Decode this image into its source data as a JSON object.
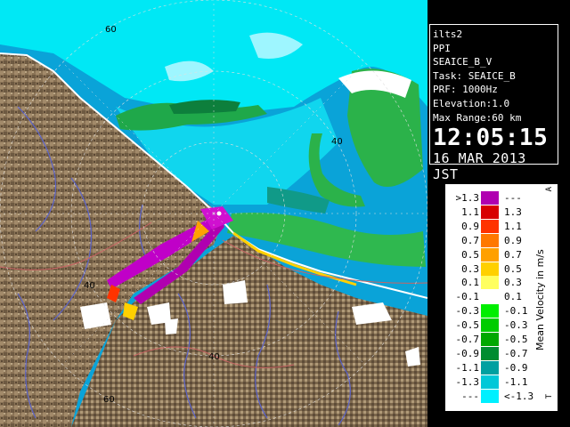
{
  "info": {
    "site": "ilts2",
    "product": "PPI",
    "product_name": "SEAICE_B_V",
    "task": "Task: SEAICE_B",
    "prf": "PRF: 1000Hz",
    "elevation": "Elevation:1.0",
    "max_range": "Max Range:60 km",
    "time": "12:05:15",
    "date": "16 MAR 2013 JST"
  },
  "range_labels": {
    "north_60": "60",
    "ne_40": "40",
    "west_40": "40",
    "south_40": "40",
    "south_60": "60"
  },
  "legend": {
    "title": "Mean Velocity in m/s",
    "mark_top": "A",
    "mark_bottom": "T",
    "rows": [
      {
        "lo": ">1.3",
        "hi": "---",
        "color": "#b000b0"
      },
      {
        "lo": "1.1",
        "hi": "1.3",
        "color": "#d80000"
      },
      {
        "lo": "0.9",
        "hi": "1.1",
        "color": "#ff3300"
      },
      {
        "lo": "0.7",
        "hi": "0.9",
        "color": "#ff7800"
      },
      {
        "lo": "0.5",
        "hi": "0.7",
        "color": "#ffa000"
      },
      {
        "lo": "0.3",
        "hi": "0.5",
        "color": "#ffd000"
      },
      {
        "lo": "0.1",
        "hi": "0.3",
        "color": "#ffff60"
      },
      {
        "lo": "-0.1",
        "hi": "0.1",
        "color": "#ffffff"
      },
      {
        "lo": "-0.3",
        "hi": "-0.1",
        "color": "#00ee00"
      },
      {
        "lo": "-0.5",
        "hi": "-0.3",
        "color": "#00cc00"
      },
      {
        "lo": "-0.7",
        "hi": "-0.5",
        "color": "#00a800"
      },
      {
        "lo": "-0.9",
        "hi": "-0.7",
        "color": "#008c30"
      },
      {
        "lo": "-1.1",
        "hi": "-0.9",
        "color": "#00a0a0"
      },
      {
        "lo": "-1.3",
        "hi": "-1.1",
        "color": "#00c8d8"
      },
      {
        "lo": "---",
        "hi": "<-1.3",
        "color": "#00f0ff"
      }
    ]
  }
}
